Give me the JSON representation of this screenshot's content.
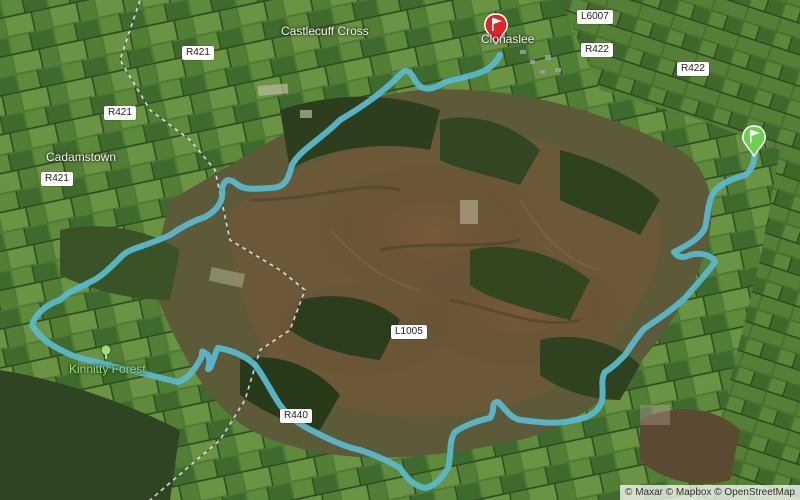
{
  "map": {
    "type": "satellite",
    "place_labels": {
      "castlecuff_cross": "Castlecuff Cross",
      "clonaslee": "Clonaslee",
      "cadamstown": "Cadamstown",
      "kinnitty_forest": "Kinnitty Forest"
    },
    "road_labels": {
      "r421_top": "R421",
      "r421_mid": "R421",
      "r421_left": "R421",
      "r422_top": "R422",
      "r422_right": "R422",
      "l6007": "L6007",
      "l1005": "L1005",
      "r440": "R440"
    },
    "route": {
      "color": "#5ab8cc",
      "start_marker": {
        "color": "#6ccf4f",
        "icon": "flag-icon"
      },
      "end_marker": {
        "color": "#e0242a",
        "icon": "flag-icon"
      }
    },
    "attribution": "© Maxar © Mapbox © OpenStreetMap"
  }
}
